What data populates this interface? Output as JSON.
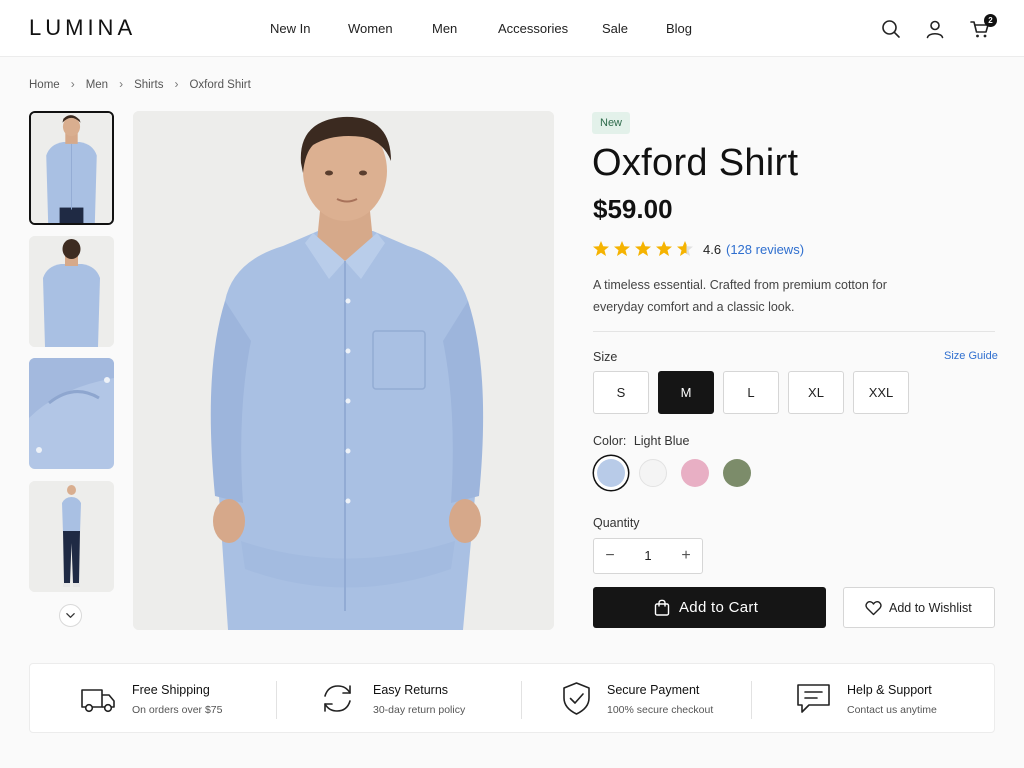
{
  "brand": {
    "logo": "LUMINA"
  },
  "nav": {
    "items": [
      "New In",
      "Women",
      "Men",
      "Accessories",
      "Sale",
      "Blog"
    ]
  },
  "header": {
    "cart_count": "2",
    "icons": [
      "search-icon",
      "user-icon",
      "cart-icon"
    ]
  },
  "breadcrumb": {
    "items": [
      "Home",
      "Men",
      "Shirts",
      "Oxford Shirt"
    ]
  },
  "product": {
    "badge": "New",
    "title": "Oxford Shirt",
    "price": "$59.00",
    "rating": "4.6",
    "rating_value": 4.6,
    "reviews": "(128 reviews)",
    "description": "A timeless essential. Crafted from premium cotton for everyday comfort and a classic look."
  },
  "size": {
    "label": "Size",
    "guide_label": "Size Guide",
    "options": [
      "S",
      "M",
      "L",
      "XL",
      "XXL"
    ],
    "selected": "M"
  },
  "color": {
    "label": "Color:",
    "selected_name": "Light Blue",
    "swatches": [
      {
        "name": "Light Blue",
        "hex": "#b8cbe8"
      },
      {
        "name": "White",
        "hex": "#f4f4f4"
      },
      {
        "name": "Pink",
        "hex": "#e8afc4"
      },
      {
        "name": "Olive",
        "hex": "#7c8c6a"
      }
    ]
  },
  "quantity": {
    "label": "Quantity",
    "value": "1",
    "minus": "−",
    "plus": "+"
  },
  "actions": {
    "add_to_cart": "Add to Cart",
    "add_to_wishlist": "Add to Wishlist"
  },
  "features": [
    {
      "icon": "truck-icon",
      "title": "Free Shipping",
      "subtitle": "On orders over $75"
    },
    {
      "icon": "returns-icon",
      "title": "Easy Returns",
      "subtitle": "30-day return policy"
    },
    {
      "icon": "shield-check-icon",
      "title": "Secure Payment",
      "subtitle": "100% secure checkout"
    },
    {
      "icon": "chat-icon",
      "title": "Help & Support",
      "subtitle": "Contact us anytime"
    }
  ],
  "colors": {
    "accent_link": "#2f6fcf",
    "primary_dark": "#151515",
    "badge_bg": "#e3f1ea",
    "badge_text": "#2e6b4b",
    "star": "#f5b301"
  }
}
